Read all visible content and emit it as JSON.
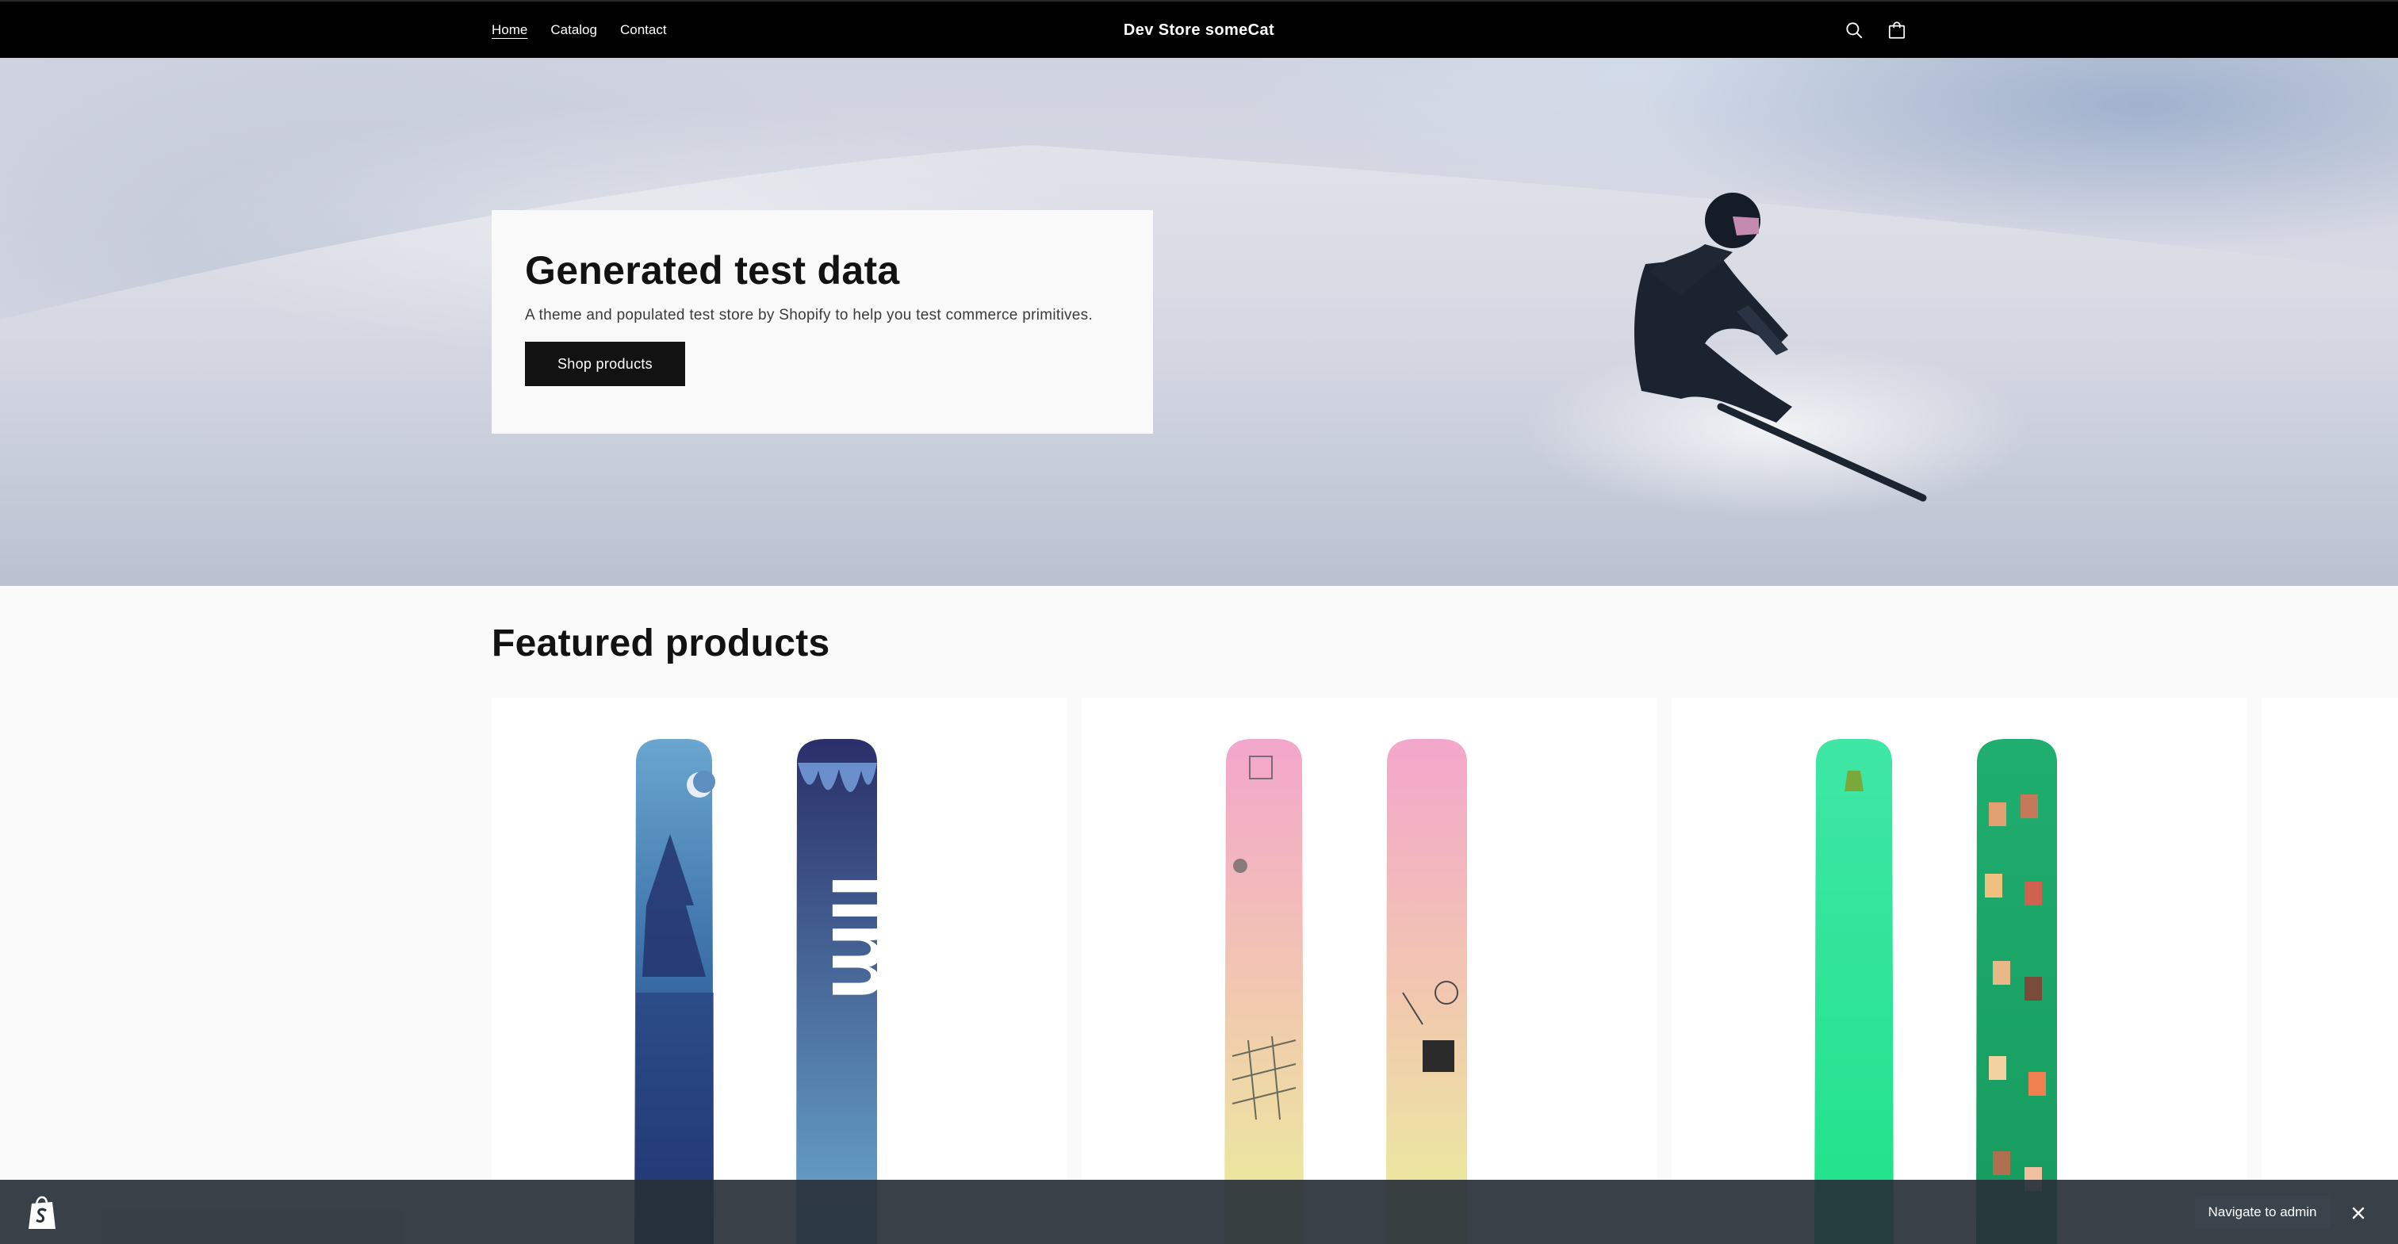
{
  "header": {
    "nav": [
      {
        "label": "Home",
        "active": true
      },
      {
        "label": "Catalog",
        "active": false
      },
      {
        "label": "Contact",
        "active": false
      }
    ],
    "brand": "Dev Store someCat",
    "icons": [
      "search-icon",
      "cart-icon"
    ]
  },
  "hero": {
    "title": "Generated test data",
    "subtitle": "A theme and populated test store by Shopify to help you test commerce primitives.",
    "button_label": "Shop products"
  },
  "featured": {
    "title": "Featured products"
  },
  "admin_bar": {
    "button_label": "Navigate to admin",
    "icons": [
      "shopify-bag-icon",
      "close-icon"
    ]
  },
  "colors": {
    "header_bg": "#000000",
    "primary_button": "#121212",
    "page_bg": "#fafafa",
    "admin_bar_bg": "#283038"
  }
}
